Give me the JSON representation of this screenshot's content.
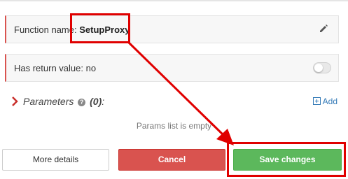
{
  "function_name_row": {
    "label": "Function name:",
    "value": "SetupProxy",
    "edit_icon": "pencil-icon"
  },
  "return_value_row": {
    "label": "Has return value: no",
    "toggle_icon": "toggle-switch-off"
  },
  "parameters": {
    "title": "Parameters",
    "help_icon": "question-circle-icon",
    "count": "(0)",
    "colon": ":",
    "add_label": "Add",
    "empty_message": "Params list is empty"
  },
  "buttons": {
    "more_details": "More details",
    "cancel": "Cancel",
    "save": "Save changes"
  },
  "colors": {
    "accent_red": "#d9534f",
    "save_green": "#5cb85c",
    "link_blue": "#337ab7",
    "annotation_red": "#e00000"
  }
}
